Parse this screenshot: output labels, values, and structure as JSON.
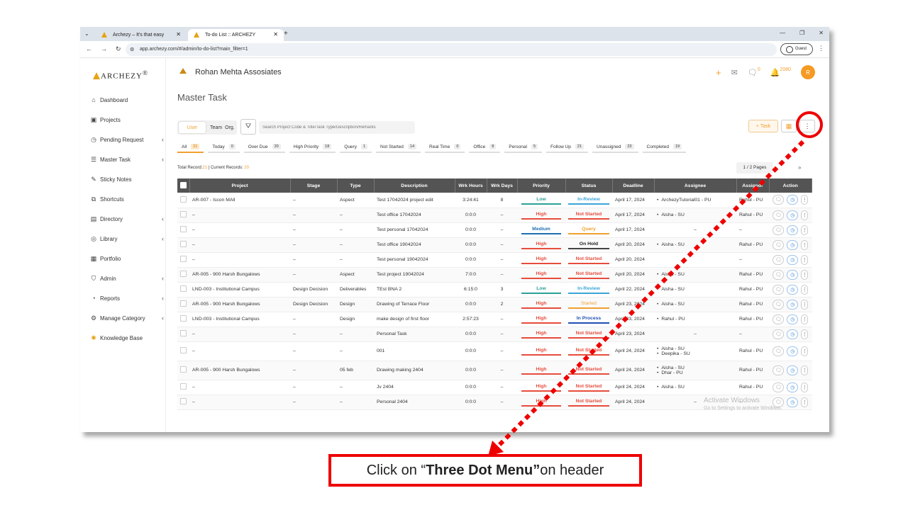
{
  "browser": {
    "tabs": [
      {
        "label": "Archezy – It's that easy"
      },
      {
        "label": "To-do List :: ARCHEZY"
      }
    ],
    "url": "app.archezy.com/#/admin/to-do-list?main_filter=1",
    "profile": "Guest"
  },
  "brand": "ARCHEZY",
  "brand_mark": "®",
  "sidebar": {
    "items": [
      {
        "label": "Dashboard",
        "icon": "home-icon"
      },
      {
        "label": "Projects",
        "icon": "projects-icon"
      },
      {
        "label": "Pending Request",
        "icon": "pending-icon"
      },
      {
        "label": "Master Task",
        "icon": "tasks-icon"
      },
      {
        "label": "Sticky Notes",
        "icon": "note-icon"
      },
      {
        "label": "Shortcuts",
        "icon": "shortcut-icon"
      },
      {
        "label": "Directory",
        "icon": "directory-icon"
      },
      {
        "label": "Library",
        "icon": "library-icon"
      },
      {
        "label": "Portfolio",
        "icon": "portfolio-icon"
      },
      {
        "label": "Admin",
        "icon": "admin-icon"
      },
      {
        "label": "Reports",
        "icon": "reports-icon"
      },
      {
        "label": "Manage Category",
        "icon": "category-icon"
      },
      {
        "label": "Knowledge Base",
        "icon": "bulb-icon"
      }
    ]
  },
  "header": {
    "company": "Rohan Mehta Assosiates",
    "comment_count": "0",
    "bell_count": "2080",
    "avatar": "R"
  },
  "page_title": "Master Task",
  "toolbar": {
    "seg_user": "User",
    "seg_team": "Team",
    "seg_org": "Org.",
    "search_placeholder": "Search Project Code & Title/Task Type/Description/Remarks",
    "task_label": "Task"
  },
  "filters": [
    {
      "label": "All",
      "count": "21"
    },
    {
      "label": "Today",
      "count": "0"
    },
    {
      "label": "Over Due",
      "count": "20"
    },
    {
      "label": "High Priority",
      "count": "18"
    },
    {
      "label": "Query",
      "count": "1"
    },
    {
      "label": "Not Started",
      "count": "14"
    },
    {
      "label": "Real Time",
      "count": "0"
    },
    {
      "label": "Office",
      "count": "8"
    },
    {
      "label": "Personal",
      "count": "5"
    },
    {
      "label": "Follow Up",
      "count": "21"
    },
    {
      "label": "Unassigned",
      "count": "23"
    },
    {
      "label": "Completed",
      "count": "19"
    }
  ],
  "records": {
    "total_label": "Total Record:",
    "total": "21",
    "sep": " | Current Records: ",
    "current": "20",
    "pages": "1 / 2 Pages"
  },
  "table": {
    "headers": [
      "Project",
      "Stage",
      "Type",
      "Description",
      "Wrk Hours",
      "Wrk Days",
      "Priority",
      "Status",
      "Deadline",
      "Assignee",
      "Assignor",
      "Action"
    ],
    "rows": [
      {
        "project": "AR-007 - Iscon MAll",
        "stage": "–",
        "type": "Aspect",
        "desc": "Test 17042024 project edit",
        "hours": "3:24:41",
        "days": "8",
        "priority": "Low",
        "pc": "low",
        "status": "In-Review",
        "sc": "inreview",
        "deadline": "April 17, 2024",
        "assignee": [
          "ArchezyTutorial01 - PU"
        ],
        "assignor": "Rahul - PU"
      },
      {
        "project": "–",
        "stage": "–",
        "type": "–",
        "desc": "Test office 17042024",
        "hours": "0:0:0",
        "days": "–",
        "priority": "High",
        "pc": "high",
        "status": "Not Started",
        "sc": "notstarted",
        "deadline": "April 17, 2024",
        "assignee": [
          "Aisha - SU"
        ],
        "assignor": "Rahul - PU"
      },
      {
        "project": "–",
        "stage": "–",
        "type": "–",
        "desc": "Test personal 17042024",
        "hours": "0:0:0",
        "days": "–",
        "priority": "Medium",
        "pc": "medium",
        "status": "Query",
        "sc": "query",
        "deadline": "April 17, 2024",
        "assignee": [],
        "assignee_dash": "–",
        "assignor": "–"
      },
      {
        "project": "–",
        "stage": "–",
        "type": "–",
        "desc": "Test office 19042024",
        "hours": "0:0:0",
        "days": "–",
        "priority": "High",
        "pc": "high",
        "status": "On Hold",
        "sc": "onhold",
        "deadline": "April 20, 2024",
        "assignee": [
          "Aisha - SU"
        ],
        "assignor": "Rahul - PU"
      },
      {
        "project": "–",
        "stage": "–",
        "type": "–",
        "desc": "Test personal 19042024",
        "hours": "0:0:0",
        "days": "–",
        "priority": "High",
        "pc": "high",
        "status": "Not Started",
        "sc": "notstarted",
        "deadline": "April 20, 2024",
        "assignee": [],
        "assignee_dash": "",
        "assignor": "–"
      },
      {
        "project": "AR-005 - 900 Harsh Bungalows",
        "stage": "–",
        "type": "Aspect",
        "desc": "Test project 19042024",
        "hours": "7:0:0",
        "days": "–",
        "priority": "High",
        "pc": "high",
        "status": "Not Started",
        "sc": "notstarted",
        "deadline": "April 20, 2024",
        "assignee": [
          "Aisha - SU"
        ],
        "assignor": "Rahul - PU"
      },
      {
        "project": "LND-003 - Institutional Campus",
        "stage": "Design Decision",
        "type": "Deliverables",
        "desc": "TEst BNA 2",
        "hours": "6:15:0",
        "days": "3",
        "priority": "Low",
        "pc": "low",
        "status": "In-Review",
        "sc": "inreview",
        "deadline": "April 22, 2024",
        "assignee": [
          "Aisha - SU"
        ],
        "assignor": "Rahul - PU"
      },
      {
        "project": "AR-005 - 900 Harsh Bungalows",
        "stage": "Design Decision",
        "type": "Design",
        "desc": "Drawing of Terrace Floor",
        "hours": "0:0:0",
        "days": "2",
        "priority": "High",
        "pc": "high",
        "status": "Started",
        "sc": "started",
        "deadline": "April 23, 2024",
        "assignee": [
          "Aisha - SU"
        ],
        "assignor": "Rahul - PU"
      },
      {
        "project": "LND-003 - Institutional Campus",
        "stage": "–",
        "type": "Design",
        "desc": "make design of first floor",
        "hours": "2:57:23",
        "days": "–",
        "priority": "High",
        "pc": "high",
        "status": "In Process",
        "sc": "inprocess",
        "deadline": "April 23, 2024",
        "assignee": [
          "Rahul - PU"
        ],
        "assignor": "Rahul - PU"
      },
      {
        "project": "–",
        "stage": "–",
        "type": "–",
        "desc": "Personal Task",
        "hours": "0:0:0",
        "days": "–",
        "priority": "High",
        "pc": "high",
        "status": "Not Started",
        "sc": "notstarted",
        "deadline": "April 23, 2024",
        "assignee": [],
        "assignee_dash": "–",
        "assignor": "–"
      },
      {
        "project": "–",
        "stage": "–",
        "type": "–",
        "desc": "001",
        "hours": "0:0:0",
        "days": "–",
        "priority": "High",
        "pc": "high",
        "status": "Not Started",
        "sc": "notstarted",
        "deadline": "April 24, 2024",
        "assignee": [
          "Aisha - SU",
          "Deepika - SU"
        ],
        "assignor": "Rahul - PU"
      },
      {
        "project": "AR-005 - 900 Harsh Bungalows",
        "stage": "–",
        "type": "05 feb",
        "desc": "Drawing making 2404",
        "hours": "0:0:0",
        "days": "–",
        "priority": "High",
        "pc": "high",
        "status": "Not Started",
        "sc": "notstarted",
        "deadline": "April 24, 2024",
        "assignee": [
          "Aisha - SU",
          "Dhar - PU"
        ],
        "assignor": "Rahul - PU"
      },
      {
        "project": "–",
        "stage": "–",
        "type": "–",
        "desc": "Jv 2404",
        "hours": "0:0:0",
        "days": "–",
        "priority": "High",
        "pc": "high",
        "status": "Not Started",
        "sc": "notstarted",
        "deadline": "April 24, 2024",
        "assignee": [
          "Aisha - SU"
        ],
        "assignor": "Rahul - PU"
      },
      {
        "project": "–",
        "stage": "–",
        "type": "–",
        "desc": "Personal 2404",
        "hours": "0:0:0",
        "days": "–",
        "priority": "High",
        "pc": "high",
        "status": "Not Started",
        "sc": "notstarted",
        "deadline": "April 24, 2024",
        "assignee": [],
        "assignee_dash": "–",
        "assignor": "–"
      }
    ]
  },
  "watermark": {
    "title": "Activate Windows",
    "sub": "Go to Settings to activate Windows."
  },
  "callout": {
    "pre": "Click on “",
    "bold": "Three Dot Menu”",
    "post": " on header"
  },
  "colors": {
    "accent": "#f0a030",
    "callout_red": "#ee0000",
    "header_bg": "#545454"
  }
}
